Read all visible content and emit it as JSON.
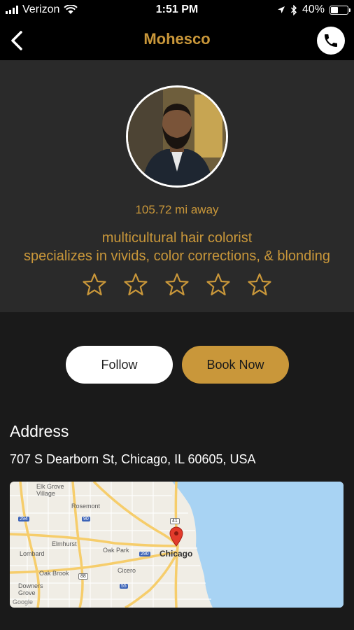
{
  "status_bar": {
    "carrier": "Verizon",
    "time": "1:51 PM",
    "battery_percent": "40%",
    "battery_level": 0.4
  },
  "nav": {
    "title": "Mohesco",
    "back_icon": "chevron-left-icon",
    "call_icon": "phone-icon"
  },
  "profile": {
    "distance": "105.72 mi away",
    "bio_line1": "multicultural hair colorist",
    "bio_line2": "specializes in vivids, color corrections, & blonding",
    "rating": 0,
    "rating_max": 5
  },
  "actions": {
    "follow_label": "Follow",
    "book_label": "Book Now"
  },
  "address": {
    "heading": "Address",
    "line": "707 S Dearborn St, Chicago, IL 60605, USA"
  },
  "map": {
    "labels": {
      "elk_grove": "Elk Grove",
      "village": "Village",
      "rosemont": "Rosemont",
      "elmhurst": "Elmhurst",
      "lombard": "Lombard",
      "oak_park": "Oak Park",
      "oak_brook": "Oak Brook",
      "cicero": "Cicero",
      "downers_grove": "Downers",
      "grove": "Grove",
      "chicago": "Chicago",
      "google": "Google"
    },
    "shields": {
      "i294": "294",
      "i290": "290",
      "i90": "90",
      "i41": "41",
      "i55": "55",
      "i88": "88"
    },
    "colors": {
      "land": "#f0ede5",
      "water": "#a8d3f3",
      "highway": "#f6cd6b",
      "pin": "#e23b2b"
    }
  },
  "colors": {
    "accent": "#c9973a",
    "background": "#1a1a1a",
    "panel": "#2a2a2a"
  }
}
